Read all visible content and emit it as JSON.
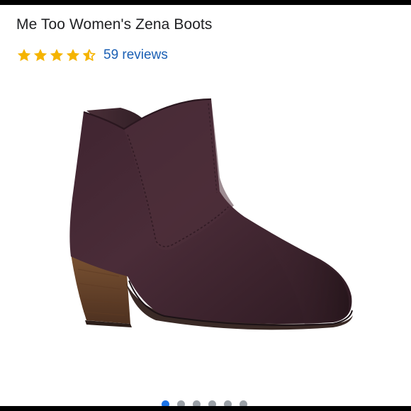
{
  "product": {
    "title": "Me Too Women's Zena Boots",
    "rating": 4.5,
    "rating_max": 5,
    "reviews_label": "59 reviews"
  },
  "colors": {
    "star": "#f5b400",
    "link": "#1a5fb4",
    "dot_active": "#1a73e8",
    "dot_inactive": "#9aa0a6"
  },
  "carousel": {
    "count": 6,
    "active_index": 0
  },
  "icons": {
    "star": "star-icon",
    "half_star": "star-half-icon"
  }
}
